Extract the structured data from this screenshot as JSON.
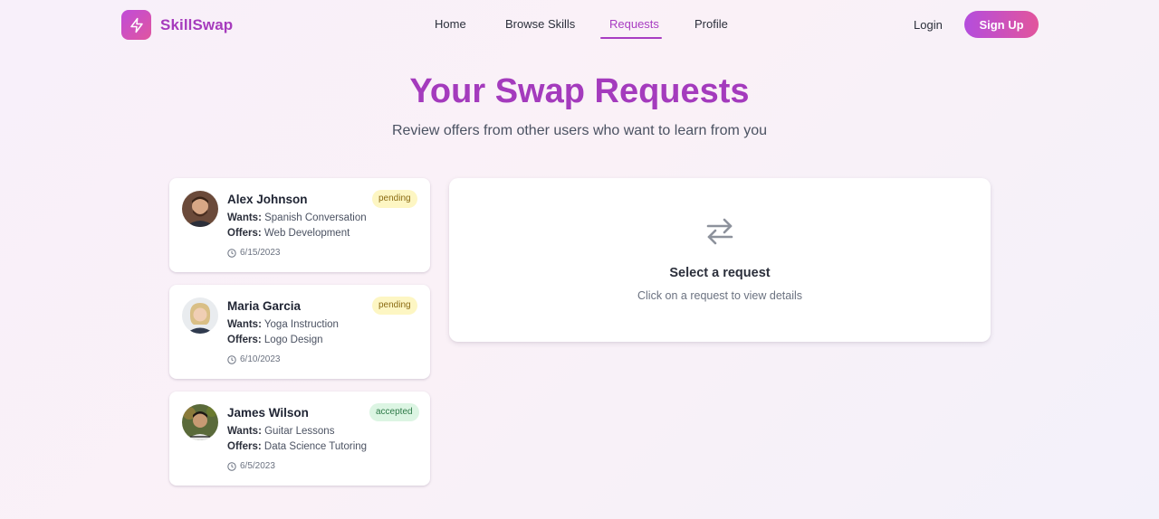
{
  "brand": {
    "name": "SkillSwap",
    "icon": "lightning-bolt-icon"
  },
  "nav": {
    "items": [
      {
        "label": "Home",
        "active": false
      },
      {
        "label": "Browse Skills",
        "active": false
      },
      {
        "label": "Requests",
        "active": true
      },
      {
        "label": "Profile",
        "active": false
      }
    ],
    "login_label": "Login",
    "signup_label": "Sign Up"
  },
  "hero": {
    "title": "Your Swap Requests",
    "subtitle": "Review offers from other users who want to learn from you"
  },
  "requests": [
    {
      "name": "Alex Johnson",
      "status": "pending",
      "wants_label": "Wants:",
      "wants": "Spanish Conversation",
      "offers_label": "Offers:",
      "offers": "Web Development",
      "date": "6/15/2023"
    },
    {
      "name": "Maria Garcia",
      "status": "pending",
      "wants_label": "Wants:",
      "wants": "Yoga Instruction",
      "offers_label": "Offers:",
      "offers": "Logo Design",
      "date": "6/10/2023"
    },
    {
      "name": "James Wilson",
      "status": "accepted",
      "wants_label": "Wants:",
      "wants": "Guitar Lessons",
      "offers_label": "Offers:",
      "offers": "Data Science Tutoring",
      "date": "6/5/2023"
    }
  ],
  "detail": {
    "icon": "swap-arrows-icon",
    "title": "Select a request",
    "subtitle": "Click on a request to view details"
  },
  "colors": {
    "accent": "#a83dc2",
    "pending_bg": "#fdf6c3",
    "accepted_bg": "#dcf5e3"
  }
}
